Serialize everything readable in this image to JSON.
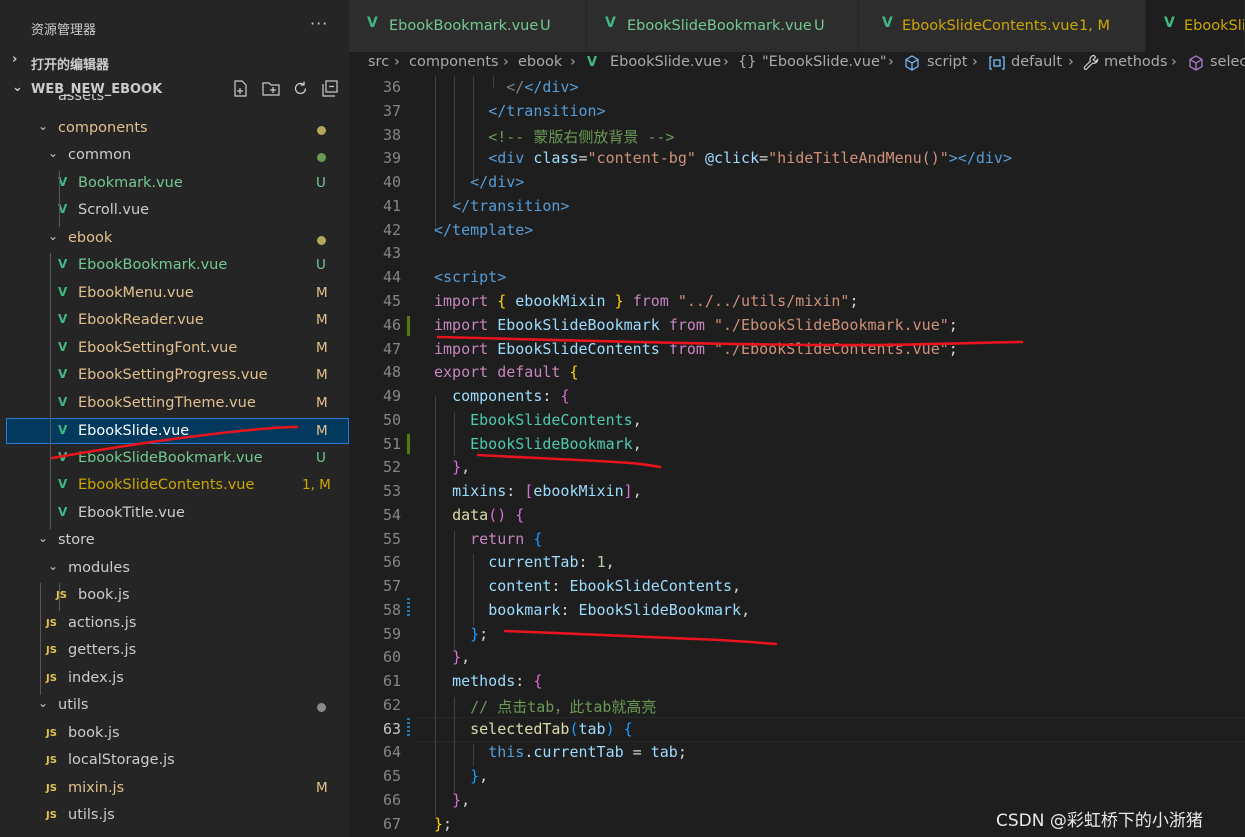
{
  "sidebar": {
    "title": "资源管理器",
    "more": "···",
    "open_editors": "打开的编辑器",
    "project": "WEB_NEW_EBOOK",
    "partial_item": "assets",
    "items": [
      {
        "label": "components",
        "kind": "folder",
        "status_dot": "#b4a85a",
        "color": "#e2c08d"
      },
      {
        "label": "common",
        "kind": "folder",
        "status_dot": "#6a9955",
        "color": "#cccccc"
      },
      {
        "label": "Bookmark.vue",
        "kind": "vue",
        "status": "U",
        "color": "#73c991"
      },
      {
        "label": "Scroll.vue",
        "kind": "vue",
        "status": "",
        "color": "#cccccc"
      },
      {
        "label": "ebook",
        "kind": "folder",
        "status_dot": "#b4a85a",
        "color": "#e2c08d"
      },
      {
        "label": "EbookBookmark.vue",
        "kind": "vue",
        "status": "U",
        "color": "#73c991"
      },
      {
        "label": "EbookMenu.vue",
        "kind": "vue",
        "status": "M",
        "color": "#e2c08d"
      },
      {
        "label": "EbookReader.vue",
        "kind": "vue",
        "status": "M",
        "color": "#e2c08d"
      },
      {
        "label": "EbookSettingFont.vue",
        "kind": "vue",
        "status": "M",
        "color": "#e2c08d"
      },
      {
        "label": "EbookSettingProgress.vue",
        "kind": "vue",
        "status": "M",
        "color": "#e2c08d"
      },
      {
        "label": "EbookSettingTheme.vue",
        "kind": "vue",
        "status": "M",
        "color": "#e2c08d"
      },
      {
        "label": "EbookSlide.vue",
        "kind": "vue",
        "status": "M",
        "color": "#ffffff"
      },
      {
        "label": "EbookSlideBookmark.vue",
        "kind": "vue",
        "status": "U",
        "color": "#73c991"
      },
      {
        "label": "EbookSlideContents.vue",
        "kind": "vue",
        "status": "1, M",
        "color": "#cca700"
      },
      {
        "label": "EbookTitle.vue",
        "kind": "vue",
        "status": "",
        "color": "#cccccc"
      },
      {
        "label": "store",
        "kind": "folder",
        "status_dot": "",
        "color": "#cccccc"
      },
      {
        "label": "modules",
        "kind": "folder",
        "status_dot": "",
        "color": "#cccccc"
      },
      {
        "label": "book.js",
        "kind": "js",
        "status": "",
        "color": "#cccccc"
      },
      {
        "label": "actions.js",
        "kind": "js",
        "status": "",
        "color": "#cccccc"
      },
      {
        "label": "getters.js",
        "kind": "js",
        "status": "",
        "color": "#cccccc"
      },
      {
        "label": "index.js",
        "kind": "js",
        "status": "",
        "color": "#cccccc"
      },
      {
        "label": "utils",
        "kind": "folder",
        "status_dot": "#8b8b8b",
        "color": "#cccccc"
      },
      {
        "label": "book.js",
        "kind": "js",
        "status": "",
        "color": "#cccccc"
      },
      {
        "label": "localStorage.js",
        "kind": "js",
        "status": "",
        "color": "#cccccc"
      },
      {
        "label": "mixin.js",
        "kind": "js",
        "status": "M",
        "color": "#e2c08d"
      },
      {
        "label": "utils.js",
        "kind": "js",
        "status": "",
        "color": "#cccccc"
      }
    ]
  },
  "tabs": [
    {
      "name": "EbookBookmark.vue",
      "status": "U",
      "color": "#73c991"
    },
    {
      "name": "EbookSlideBookmark.vue",
      "status": "U",
      "color": "#73c991"
    },
    {
      "name": "EbookSlideContents.vue",
      "status": "1, M",
      "color": "#cca700"
    },
    {
      "name": "EbookSli",
      "status": "",
      "color": "#cca700"
    }
  ],
  "breadcrumb": [
    "src",
    "components",
    "ebook",
    "EbookSlide.vue",
    "\"EbookSlide.vue\"",
    "script",
    "default",
    "methods",
    "selec"
  ],
  "breadcrumb_prefix": {
    "braces": "{}"
  },
  "editor": {
    "line_numbers": [
      "36",
      "37",
      "38",
      "39",
      "40",
      "41",
      "42",
      "43",
      "44",
      "45",
      "46",
      "47",
      "48",
      "49",
      "50",
      "51",
      "52",
      "53",
      "54",
      "55",
      "56",
      "57",
      "58",
      "59",
      "60",
      "61",
      "62",
      "63",
      "64",
      "65",
      "66",
      "67"
    ],
    "active_line": "63"
  },
  "code": {
    "l36": "</div>",
    "l37": "</transition>",
    "l38": "<!-- 蒙版右侧放背景 -->",
    "l39_tag_open": "<div",
    "l39_attr": "class",
    "l39_val": "\"content-bg\"",
    "l39_event": "@click",
    "l39_handler": "\"hideTitleAndMenu()\"",
    "l39_close": "></div>",
    "l40": "</div>",
    "l41": "</transition>",
    "l42": "</template>",
    "l44": "<script>",
    "l45_import": "import",
    "l45_name": "ebookMixin",
    "l45_from": "from",
    "l45_path": "\"../../utils/mixin\"",
    "l46_name": "EbookSlideBookmark",
    "l46_path": "\"./EbookSlideBookmark.vue\"",
    "l47_name": "EbookSlideContents",
    "l47_path": "\"./EbookSlideContents.vue\"",
    "l48_export": "export",
    "l48_default": "default",
    "l49_key": "components",
    "l50": "EbookSlideContents",
    "l51": "EbookSlideBookmark",
    "l53_key": "mixins",
    "l53_val": "ebookMixin",
    "l54_fn": "data",
    "l55": "return",
    "l56_key": "currentTab",
    "l56_val": "1",
    "l57_key": "content",
    "l57_val": "EbookSlideContents",
    "l58_key": "bookmark",
    "l58_val": "EbookSlideBookmark",
    "l61_key": "methods",
    "l62": "// 点击tab，此tab就高亮",
    "l63_fn": "selectedTab",
    "l63_param": "tab",
    "l64_this": "this",
    "l64_prop": "currentTab",
    "l64_val": "tab"
  },
  "watermark": "CSDN @彩虹桥下的小浙猪",
  "colors": {
    "annotation": "#e8141e",
    "vue": "#41b883",
    "selected_bg": "#04395e"
  }
}
